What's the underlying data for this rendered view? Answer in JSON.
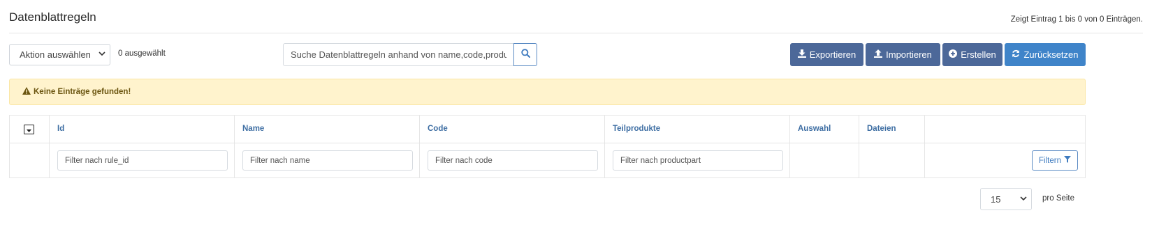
{
  "header": {
    "title": "Datenblattregeln",
    "entry_summary": "Zeigt Eintrag 1 bis 0 von 0 Einträgen."
  },
  "toolbar": {
    "action_select": {
      "value": "Aktion auswählen",
      "icon": "chevron-down-icon"
    },
    "selected_count": "0 ausgewählt",
    "search": {
      "placeholder": "Suche Datenblattregeln anhand von name,code,productpart",
      "icon": "search-icon"
    },
    "buttons": {
      "export": {
        "label": "Exportieren",
        "icon": "download-icon"
      },
      "import": {
        "label": "Importieren",
        "icon": "upload-icon"
      },
      "create": {
        "label": "Erstellen",
        "icon": "plus-circle-icon"
      },
      "reset": {
        "label": "Zurücksetzen",
        "icon": "refresh-icon"
      }
    }
  },
  "alert": {
    "icon": "warning-icon",
    "text": "Keine Einträge gefunden!"
  },
  "table": {
    "columns": [
      "Id",
      "Name",
      "Code",
      "Teilprodukte",
      "Auswahl",
      "Dateien"
    ],
    "filters": {
      "id_placeholder": "Filter nach rule_id",
      "name_placeholder": "Filter nach name",
      "code_placeholder": "Filter nach code",
      "productpart_placeholder": "Filter nach productpart"
    },
    "filter_button": {
      "label": "Filtern",
      "icon": "filter-icon"
    }
  },
  "pagination": {
    "per_page_value": "15",
    "per_page_label": "pro Seite"
  },
  "colors": {
    "primary_dark": "#4c6899",
    "primary_light": "#3f84c9",
    "header_link": "#3e6ea3",
    "alert_bg": "#fff3cd",
    "alert_text": "#6b5510"
  }
}
